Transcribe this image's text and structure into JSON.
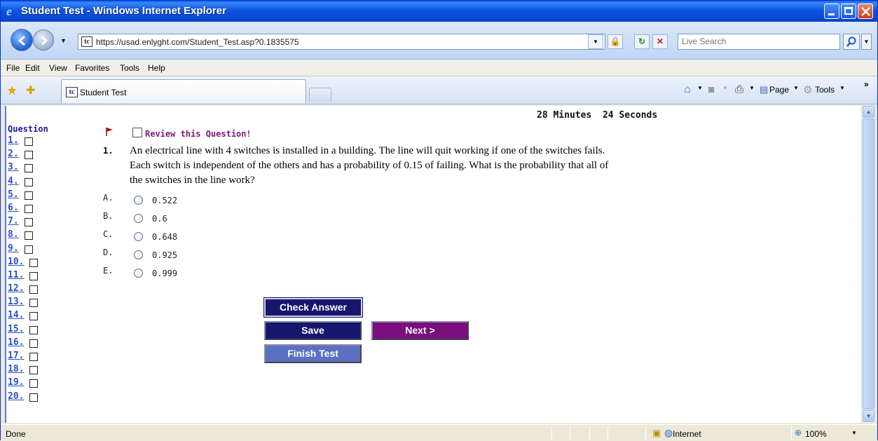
{
  "window": {
    "title": "Student Test - Windows Internet Explorer"
  },
  "address_bar": {
    "url": "https://usad.enlyght.com/Student_Test.asp?0.1835575",
    "search_placeholder": "Live Search"
  },
  "menu": {
    "items": [
      "File",
      "Edit",
      "View",
      "Favorites",
      "Tools",
      "Help"
    ]
  },
  "tabs": {
    "active_label": "Student Test",
    "favicon_text": "tc"
  },
  "command_bar": {
    "page_label": "Page",
    "tools_label": "Tools"
  },
  "test": {
    "timer_minutes": "28 Minutes",
    "timer_seconds": "24 Seconds",
    "question_header": "Question",
    "question_numbers": [
      "1.",
      "2.",
      "3.",
      "4.",
      "5.",
      "6.",
      "7.",
      "8.",
      "9.",
      "10.",
      "11.",
      "12.",
      "13.",
      "14.",
      "15.",
      "16.",
      "17.",
      "18.",
      "19.",
      "20."
    ],
    "review_label": "Review this Question!",
    "current_number": "1.",
    "question_text": "An electrical line with 4 switches is installed in a building. The line will quit working if one of the switches fails. Each switch is independent of the others and has a probability of 0.15 of failing. What is the probability that all of the switches in the line work?",
    "options": [
      {
        "letter": "A.",
        "value": "0.522"
      },
      {
        "letter": "B.",
        "value": "0.6"
      },
      {
        "letter": "C.",
        "value": "0.648"
      },
      {
        "letter": "D.",
        "value": "0.925"
      },
      {
        "letter": "E.",
        "value": "0.999"
      }
    ],
    "buttons": {
      "check": "Check Answer",
      "save": "Save",
      "next": "Next >",
      "finish": "Finish Test"
    },
    "colors": {
      "dark_navy": "#16166e",
      "purple": "#7a0f7d",
      "light_blue": "#5b70c0"
    }
  },
  "status_bar": {
    "status": "Done",
    "zone": "Internet",
    "zoom": "100%"
  }
}
